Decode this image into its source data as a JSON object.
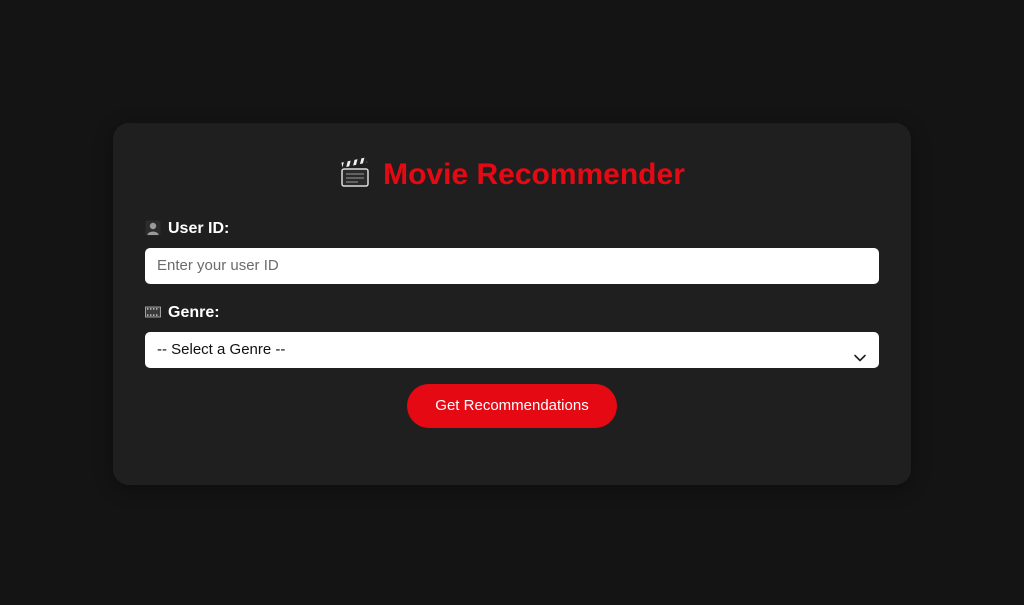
{
  "app": {
    "title": "Movie Recommender",
    "title_icon": "clapper-board-icon",
    "accent_color": "#e50914",
    "background_color": "#141414",
    "card_color": "#1f1f1f"
  },
  "form": {
    "user_id": {
      "label": "User ID:",
      "icon": "user-silhouette-icon",
      "value": "",
      "placeholder": "Enter your user ID"
    },
    "genre": {
      "label": "Genre:",
      "icon": "film-strip-icon",
      "selected": "-- Select a Genre --"
    },
    "submit_label": "Get Recommendations"
  }
}
